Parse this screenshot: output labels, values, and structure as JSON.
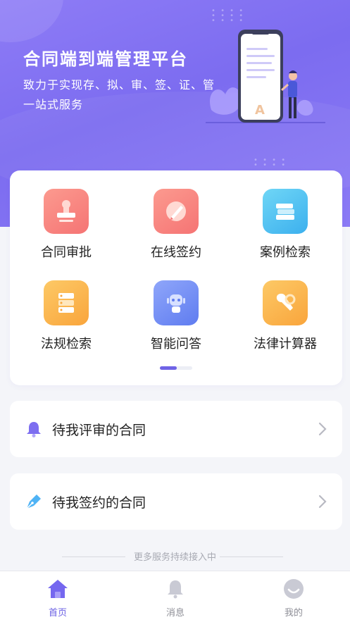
{
  "hero": {
    "title": "合同端到端管理平台",
    "subtitle": "致力于实现存、拟、审、签、证、管一站式服务"
  },
  "grid": {
    "items": [
      {
        "label": "合同审批",
        "icon": "stamp-icon",
        "color": "#f87d7b"
      },
      {
        "label": "在线签约",
        "icon": "pen-sign-icon",
        "color": "#f77a7a"
      },
      {
        "label": "案例检索",
        "icon": "books-icon",
        "color": "#4fc0f2"
      },
      {
        "label": "法规检索",
        "icon": "server-list-icon",
        "color": "#fbb34d"
      },
      {
        "label": "智能问答",
        "icon": "robot-icon",
        "color": "#6f8ff5"
      },
      {
        "label": "法律计算器",
        "icon": "wrench-search-icon",
        "color": "#fbb34d"
      }
    ]
  },
  "lists": [
    {
      "label": "待我评审的合同",
      "icon": "bell-icon"
    },
    {
      "label": "待我签约的合同",
      "icon": "pen-icon"
    }
  ],
  "footer_note": "更多服务持续接入中",
  "tabs": [
    {
      "label": "首页",
      "icon": "home-icon",
      "active": true
    },
    {
      "label": "消息",
      "icon": "bell-icon",
      "active": false
    },
    {
      "label": "我的",
      "icon": "smile-face-icon",
      "active": false
    }
  ],
  "colors": {
    "accent": "#6a5fe3",
    "hero_start": "#8e7cf6",
    "hero_end": "#7c6cf0"
  }
}
